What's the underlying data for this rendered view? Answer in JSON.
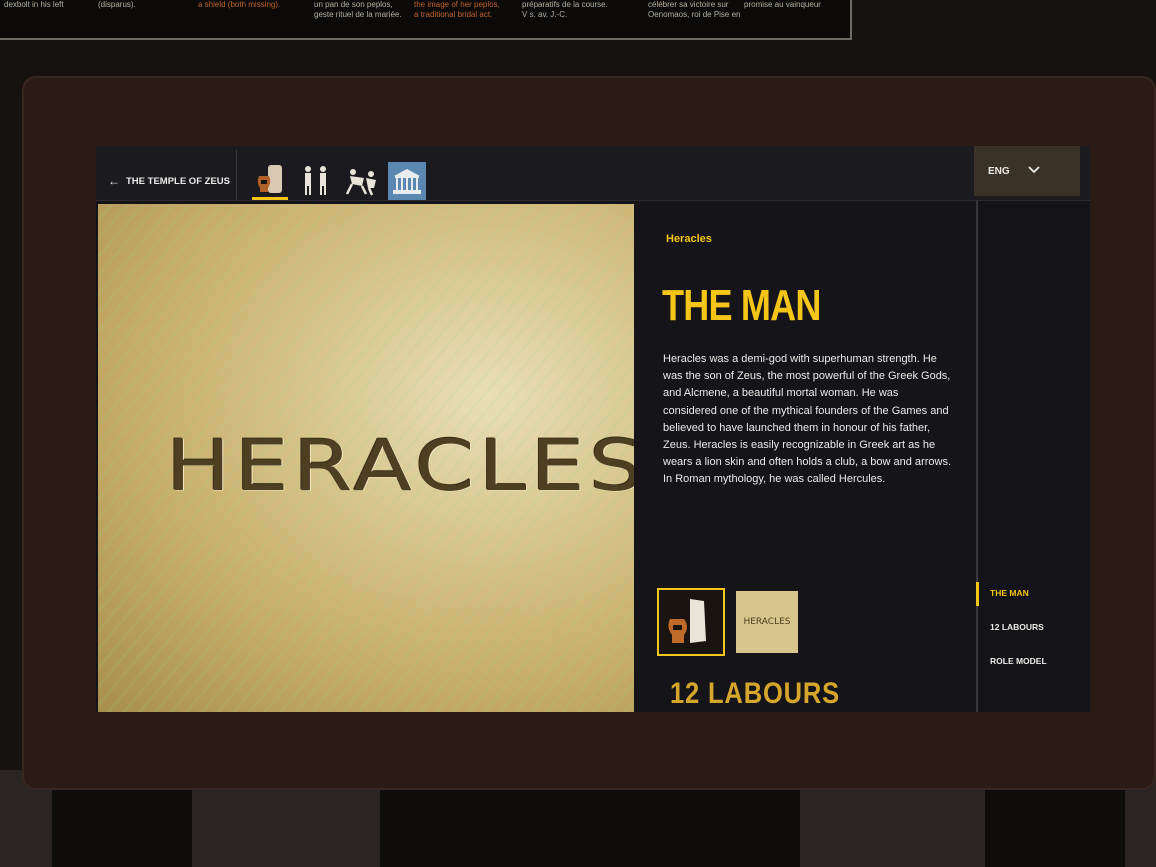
{
  "wall_caption": {
    "col1": [
      "dexbolt in his left"
    ],
    "col2": [
      "(disparus)."
    ],
    "col3": [
      "a shield (both missing)."
    ],
    "col4": [
      "un pan de son peplos,",
      "geste rituel de la mariée."
    ],
    "col5": [
      "the image of her peplos,",
      "a traditional bridal act."
    ],
    "col6": [
      "préparatifs de la course.",
      "V s. av. J.-C."
    ],
    "col7": [
      "célébrer sa victoire sur",
      "Oenomaos, roi de Pise en"
    ],
    "col8": [
      "promise au vainqueur"
    ]
  },
  "kiosk": {
    "back_label": "THE TEMPLE OF ZEUS",
    "back_icon": "arrow-left",
    "thumbnails": [
      {
        "name": "statue-and-vase"
      },
      {
        "name": "two-figures"
      },
      {
        "name": "wrestling-figures"
      },
      {
        "name": "temple-model"
      }
    ],
    "language": "ENG",
    "image_text": "HERACLES",
    "eyebrow": "Heracles",
    "title": "THE MAN",
    "body": "Heracles was a demi-god with superhuman strength. He was the son of Zeus, the most powerful of the Greek Gods, and Alcmene, a beautiful mortal woman. He was considered one of the mythical founders of the Games and believed to have launched them in honour of his father, Zeus. Heracles is easily recognizable in Greek art as he wears a lion skin and often holds a club, a bow and arrows. In Roman mythology, he was called Hercules.",
    "media_thumb_text": "HERACLES",
    "next_section_title": "12 LABOURS",
    "section_nav": [
      {
        "label": "THE MAN",
        "active": true
      },
      {
        "label": "12 LABOURS",
        "active": false
      },
      {
        "label": "ROLE MODEL",
        "active": false
      }
    ],
    "colors": {
      "accent": "#f5c518",
      "bezel": "#2b1b16",
      "panel": "#151419"
    }
  }
}
